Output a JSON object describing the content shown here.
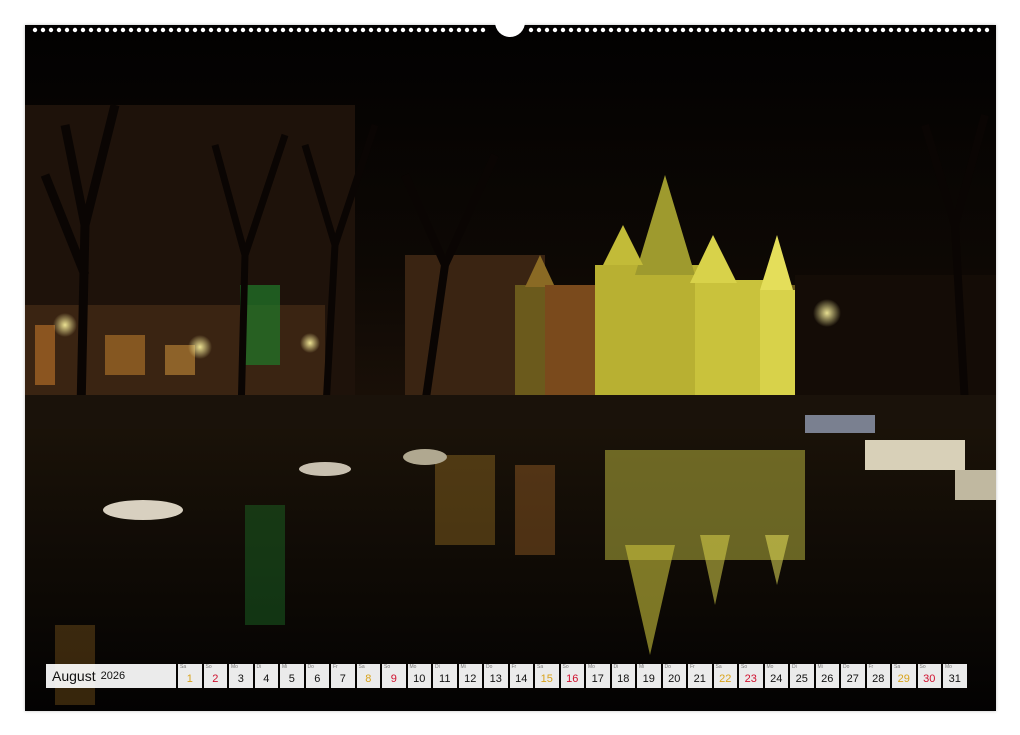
{
  "calendar": {
    "month": "August",
    "year": "2026",
    "days": [
      {
        "wd": "Sa",
        "num": "1",
        "type": "sat"
      },
      {
        "wd": "So",
        "num": "2",
        "type": "sun"
      },
      {
        "wd": "Mo",
        "num": "3",
        "type": "week"
      },
      {
        "wd": "Di",
        "num": "4",
        "type": "week"
      },
      {
        "wd": "Mi",
        "num": "5",
        "type": "week"
      },
      {
        "wd": "Do",
        "num": "6",
        "type": "week"
      },
      {
        "wd": "Fr",
        "num": "7",
        "type": "week"
      },
      {
        "wd": "Sa",
        "num": "8",
        "type": "sat"
      },
      {
        "wd": "So",
        "num": "9",
        "type": "sun"
      },
      {
        "wd": "Mo",
        "num": "10",
        "type": "week"
      },
      {
        "wd": "Di",
        "num": "11",
        "type": "week"
      },
      {
        "wd": "Mi",
        "num": "12",
        "type": "week"
      },
      {
        "wd": "Do",
        "num": "13",
        "type": "week"
      },
      {
        "wd": "Fr",
        "num": "14",
        "type": "week"
      },
      {
        "wd": "Sa",
        "num": "15",
        "type": "sat"
      },
      {
        "wd": "So",
        "num": "16",
        "type": "sun"
      },
      {
        "wd": "Mo",
        "num": "17",
        "type": "week"
      },
      {
        "wd": "Di",
        "num": "18",
        "type": "week"
      },
      {
        "wd": "Mi",
        "num": "19",
        "type": "week"
      },
      {
        "wd": "Do",
        "num": "20",
        "type": "week"
      },
      {
        "wd": "Fr",
        "num": "21",
        "type": "week"
      },
      {
        "wd": "Sa",
        "num": "22",
        "type": "sat"
      },
      {
        "wd": "So",
        "num": "23",
        "type": "sun"
      },
      {
        "wd": "Mo",
        "num": "24",
        "type": "week"
      },
      {
        "wd": "Di",
        "num": "25",
        "type": "week"
      },
      {
        "wd": "Mi",
        "num": "26",
        "type": "week"
      },
      {
        "wd": "Do",
        "num": "27",
        "type": "week"
      },
      {
        "wd": "Fr",
        "num": "28",
        "type": "week"
      },
      {
        "wd": "Sa",
        "num": "29",
        "type": "sat"
      },
      {
        "wd": "So",
        "num": "30",
        "type": "sun"
      },
      {
        "wd": "Mo",
        "num": "31",
        "type": "week"
      }
    ]
  },
  "colors": {
    "saturday": "#d9a31a",
    "sunday": "#d0102e",
    "building_glow": "#d8d24a",
    "night_sky": "#050302"
  },
  "icons": {
    "hanger_hole": "calendar-hanger-hole-icon",
    "wire_binding": "wire-binding-icon"
  }
}
